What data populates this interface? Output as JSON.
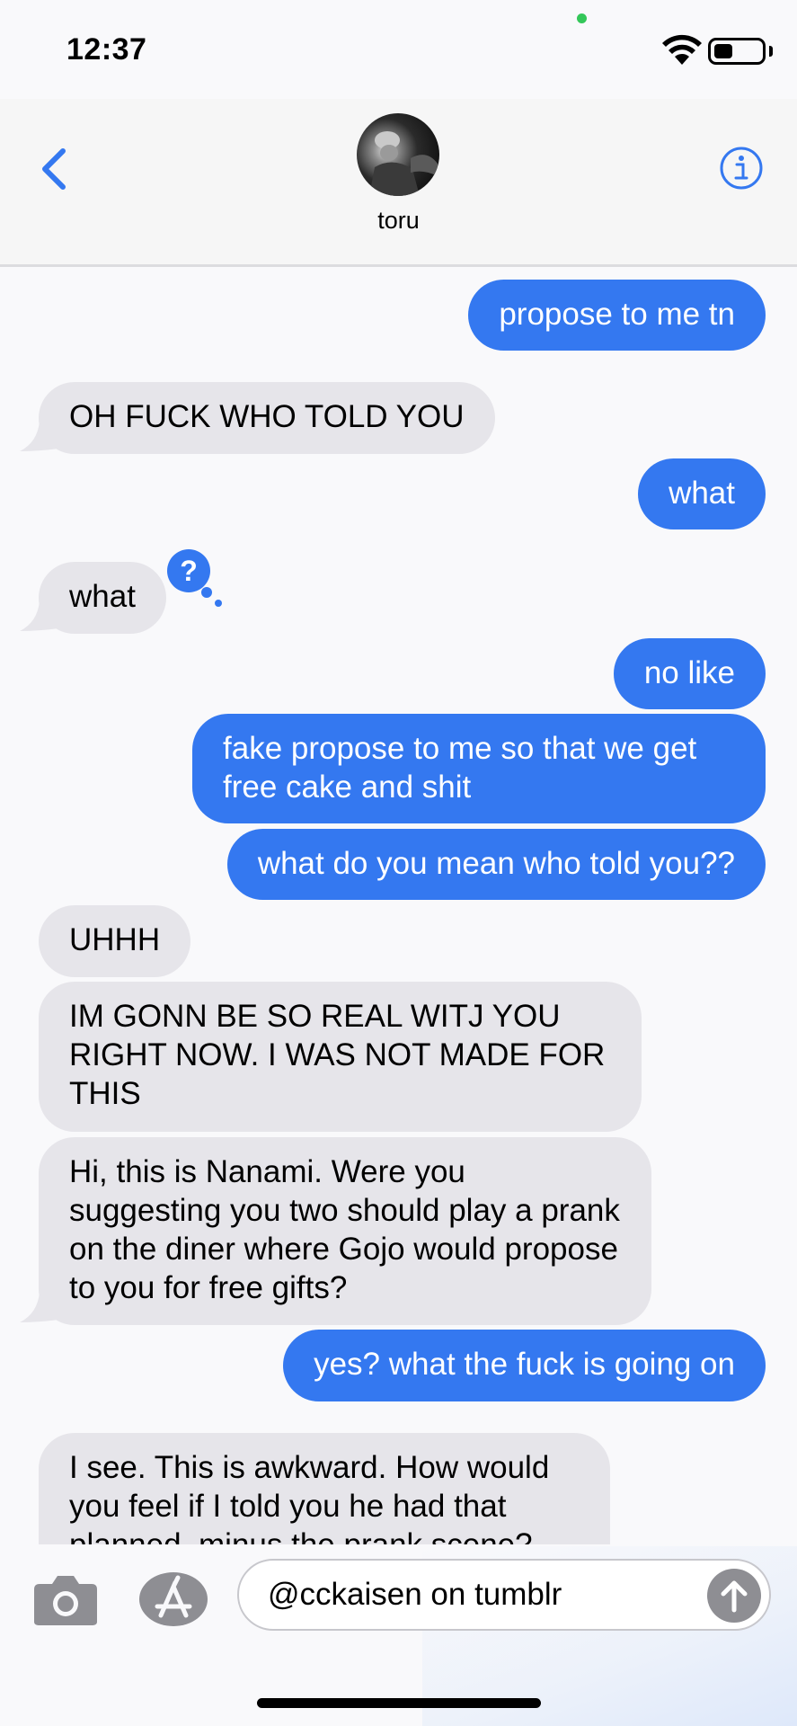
{
  "status_bar": {
    "time": "12:37",
    "battery_level": 0.4
  },
  "header": {
    "contact_name": "toru",
    "back_icon": "chevron-left-icon",
    "info_icon": "info-icon"
  },
  "messages": [
    {
      "from": "me",
      "text": "propose to me tn"
    },
    {
      "from": "them",
      "text": "OH FUCK WHO TOLD YOU"
    },
    {
      "from": "me",
      "text": "what"
    },
    {
      "from": "them",
      "text": "what",
      "reaction": "?"
    },
    {
      "from": "me",
      "text": "no like"
    },
    {
      "from": "me",
      "text": "fake propose to me so that we get free cake and shit"
    },
    {
      "from": "me",
      "text": "what do you mean who told you??"
    },
    {
      "from": "them",
      "text": "UHHH"
    },
    {
      "from": "them",
      "text": "IM GONN BE SO REAL WITJ YOU RIGHT NOW. I WAS NOT MADE FOR THIS"
    },
    {
      "from": "them",
      "text": "Hi, this is Nanami. Were you suggesting you two should play a prank on the diner where Gojo would propose to you for free gifts?"
    },
    {
      "from": "me",
      "text": "yes? what the fuck is going on"
    },
    {
      "from": "them",
      "text": "I see. This is awkward. How would you feel if I told you he had that planned, minus the prank scene?"
    }
  ],
  "compose": {
    "text": "@cckaisen on tumblr",
    "camera_icon": "camera-icon",
    "apps_icon": "app-store-icon",
    "send_icon": "send-arrow-icon"
  },
  "colors": {
    "outgoing": "#3478f0",
    "incoming": "#e6e5ea",
    "accent": "#3478f0"
  }
}
